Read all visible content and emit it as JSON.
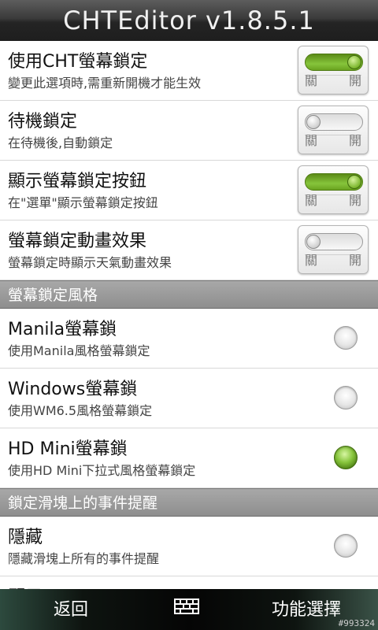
{
  "app_title": "CHTEditor v1.8.5.1",
  "toggle_rows": [
    {
      "title": "使用CHT螢幕鎖定",
      "summary": "變更此選項時,需重新開機才能生效",
      "state": "on",
      "off_label": "關",
      "on_label": "開"
    },
    {
      "title": "待機鎖定",
      "summary": "在待機後,自動鎖定",
      "state": "off",
      "off_label": "關",
      "on_label": "開"
    },
    {
      "title": "顯示螢幕鎖定按鈕",
      "summary": "在\"選單\"顯示螢幕鎖定按鈕",
      "state": "on",
      "off_label": "關",
      "on_label": "開"
    },
    {
      "title": "螢幕鎖定動畫效果",
      "summary": "螢幕鎖定時顯示天氣動畫效果",
      "state": "off",
      "off_label": "關",
      "on_label": "開"
    }
  ],
  "section_style": "螢幕鎖定風格",
  "style_rows": [
    {
      "title": "Manila螢幕鎖",
      "summary": "使用Manila風格螢幕鎖定",
      "checked": false
    },
    {
      "title": "Windows螢幕鎖",
      "summary": "使用WM6.5風格螢幕鎖定",
      "checked": false
    },
    {
      "title": "HD Mini螢幕鎖",
      "summary": "使用HD Mini下拉式風格螢幕鎖定",
      "checked": true
    }
  ],
  "section_events": "鎖定滑塊上的事件提醒",
  "event_rows": [
    {
      "title": "隱藏",
      "summary": "隱藏滑塊上所有的事件提醒",
      "checked": false
    },
    {
      "title": "顯示",
      "summary": "",
      "checked": false
    }
  ],
  "bottom": {
    "back_label": "返回",
    "menu_label": "功能選擇",
    "grid_icon": "keyboard-grid-icon",
    "watermark": "#993324"
  },
  "colors": {
    "accent_green": "#7ab52c",
    "section_gray": "#9a9a9a"
  }
}
